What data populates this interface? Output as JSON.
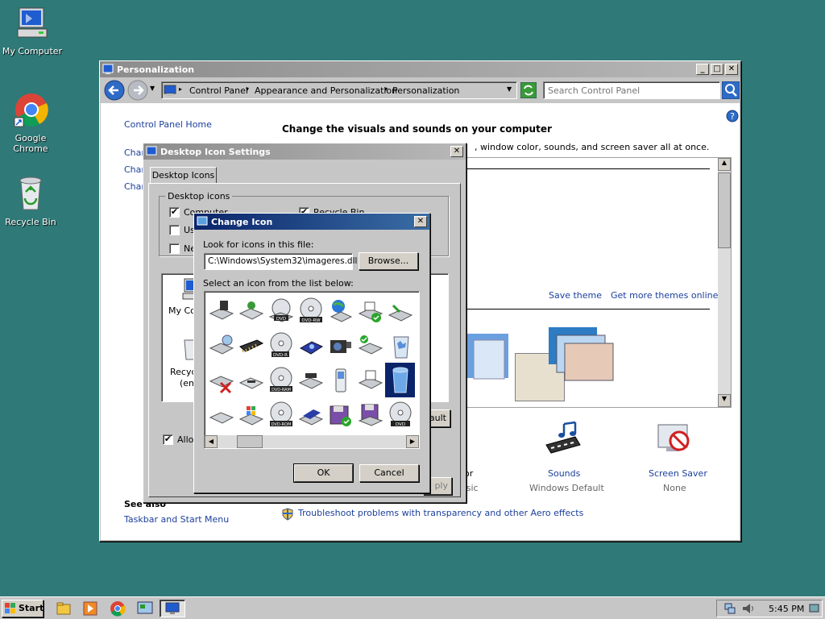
{
  "desktop": {
    "icons": [
      {
        "label": "My Computer"
      },
      {
        "label": "Google Chrome"
      },
      {
        "label": "Recycle Bin"
      }
    ]
  },
  "personalization": {
    "title": "Personalization",
    "address": {
      "crumbs": [
        "Control Panel",
        "Appearance and Personalization",
        "Personalization"
      ]
    },
    "search_placeholder": "Search Control Panel",
    "sidebar": {
      "home": "Control Panel Home",
      "links": [
        "Chan",
        "Chan",
        "Chan"
      ],
      "see_also": "See also",
      "see_also_links": [
        "Taskbar and Start Menu"
      ]
    },
    "main": {
      "heading": "Change the visuals and sounds on your computer",
      "desc": ", window color, sounds, and screen saver all at once.",
      "save_theme": "Save theme",
      "more_themes": "Get more themes online",
      "bottom_items": [
        {
          "label": "or",
          "sub": "ssic"
        },
        {
          "label": "Sounds",
          "sub": "Windows Default"
        },
        {
          "label": "Screen Saver",
          "sub": "None"
        }
      ],
      "troubleshoot": "Troubleshoot problems with transparency and other Aero effects"
    }
  },
  "desktop_icon_settings": {
    "title": "Desktop Icon Settings",
    "tab": "Desktop Icons",
    "group_label": "Desktop icons",
    "checkboxes": [
      {
        "label": "Computer",
        "checked": "✔"
      },
      {
        "label": "Recycle Bin",
        "checked": "✔"
      },
      {
        "label": "Us",
        "checked": ""
      },
      {
        "label": "Ne",
        "checked": ""
      }
    ],
    "preview_labels": [
      "My Con",
      "Recyc",
      "(em"
    ],
    "restore_default": "ault",
    "allow_label": "Allov",
    "allow_checked": "✔",
    "apply_label": "ply"
  },
  "change_icon": {
    "title": "Change Icon",
    "look_label": "Look for icons in this file:",
    "file_value": "C:\\Windows\\System32\\imageres.dll",
    "browse": "Browse...",
    "select_label": "Select an icon from the list below:",
    "ok": "OK",
    "cancel": "Cancel",
    "icon_badges": {
      "dvd": "DVD",
      "dvdrw": "DVD-RW",
      "dvdr": "DVD-R",
      "dvdram": "DVD-RAM",
      "dvdrom": "DVD-ROM"
    }
  },
  "taskbar": {
    "start": "Start",
    "time": "5:45 PM"
  },
  "colors": {
    "desktop": "#2f7a78",
    "active_title": "#0a246a",
    "link": "#1b3f9c"
  }
}
